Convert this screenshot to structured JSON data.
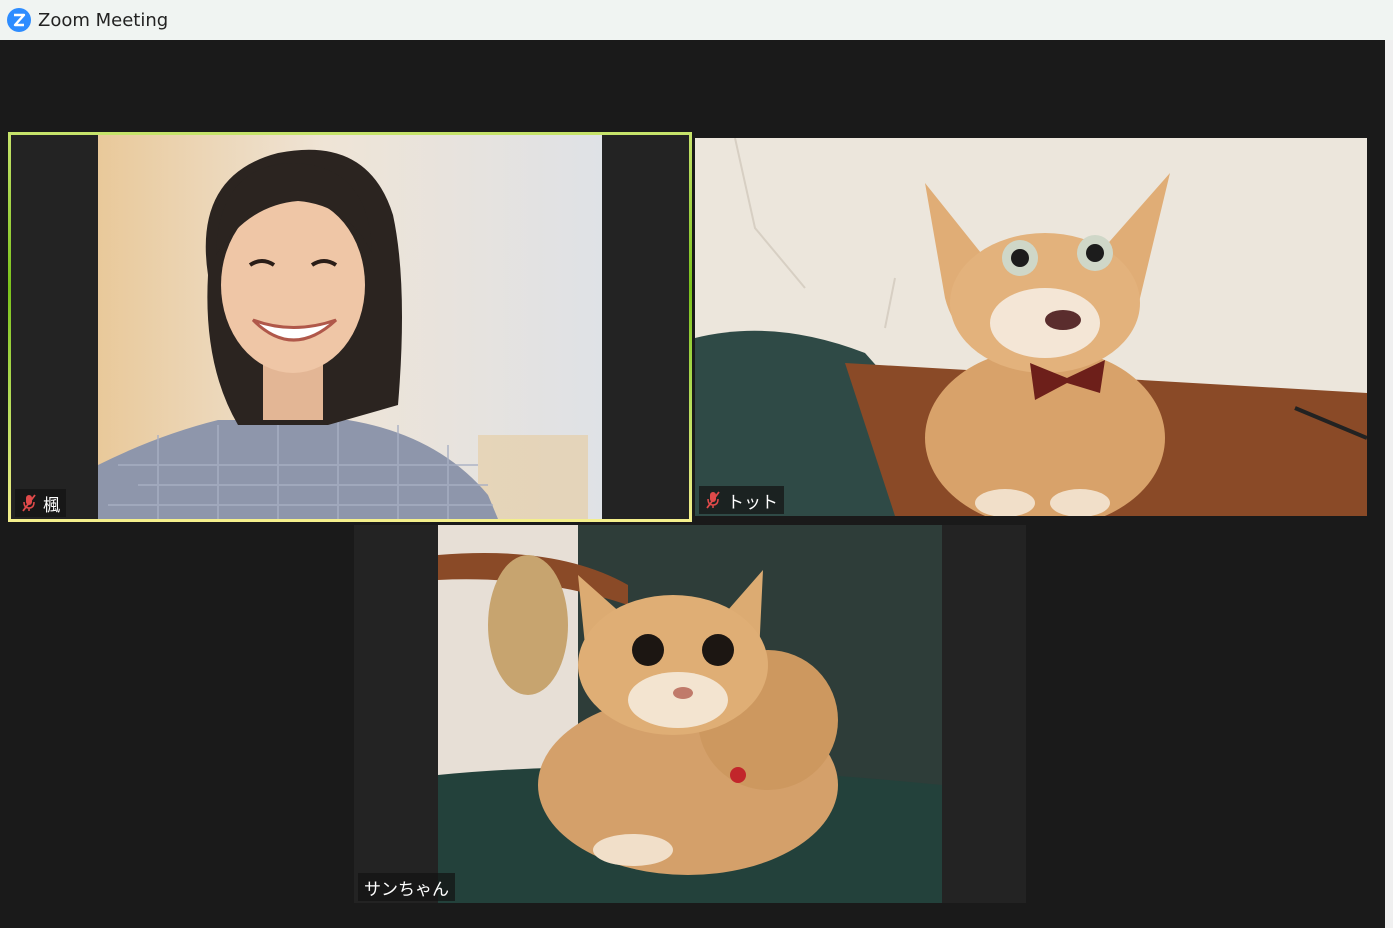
{
  "window": {
    "title": "Zoom Meeting",
    "icon": "zoom-logo-icon",
    "accent": "#2d8cff"
  },
  "participants": [
    {
      "name": "楓",
      "muted": true,
      "active_speaker": true,
      "video": "smiling woman with dark bob haircut in plaid shirt"
    },
    {
      "name": "トット",
      "muted": true,
      "active_speaker": false,
      "video": "orange tabby cat with bow-tie collar on wooden table"
    },
    {
      "name": "サンちゃん",
      "muted": false,
      "active_speaker": false,
      "video": "orange cat loafing on green cushion"
    }
  ],
  "colors": {
    "background": "#1a1a1a",
    "active_border": "#7ac21b",
    "mute_icon": "#e04a4a"
  }
}
